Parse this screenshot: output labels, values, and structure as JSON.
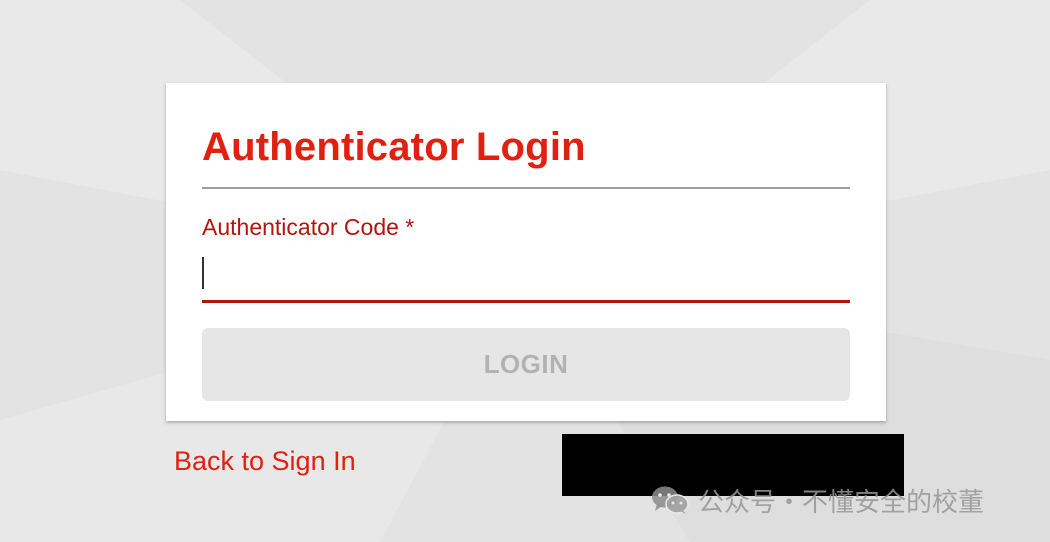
{
  "login": {
    "title": "Authenticator Login",
    "code_label": "Authenticator Code *",
    "code_value": "",
    "login_button": "LOGIN",
    "back_link": "Back to Sign In"
  },
  "watermark": {
    "icon": "wechat-icon",
    "text": "公众号・不懂安全的校董"
  },
  "colors": {
    "accent": "#e02010",
    "label_dark_red": "#b3140c",
    "button_disabled_bg": "#e6e6e6",
    "button_disabled_text": "#b2b2b2",
    "background": "#e4e4e4"
  }
}
